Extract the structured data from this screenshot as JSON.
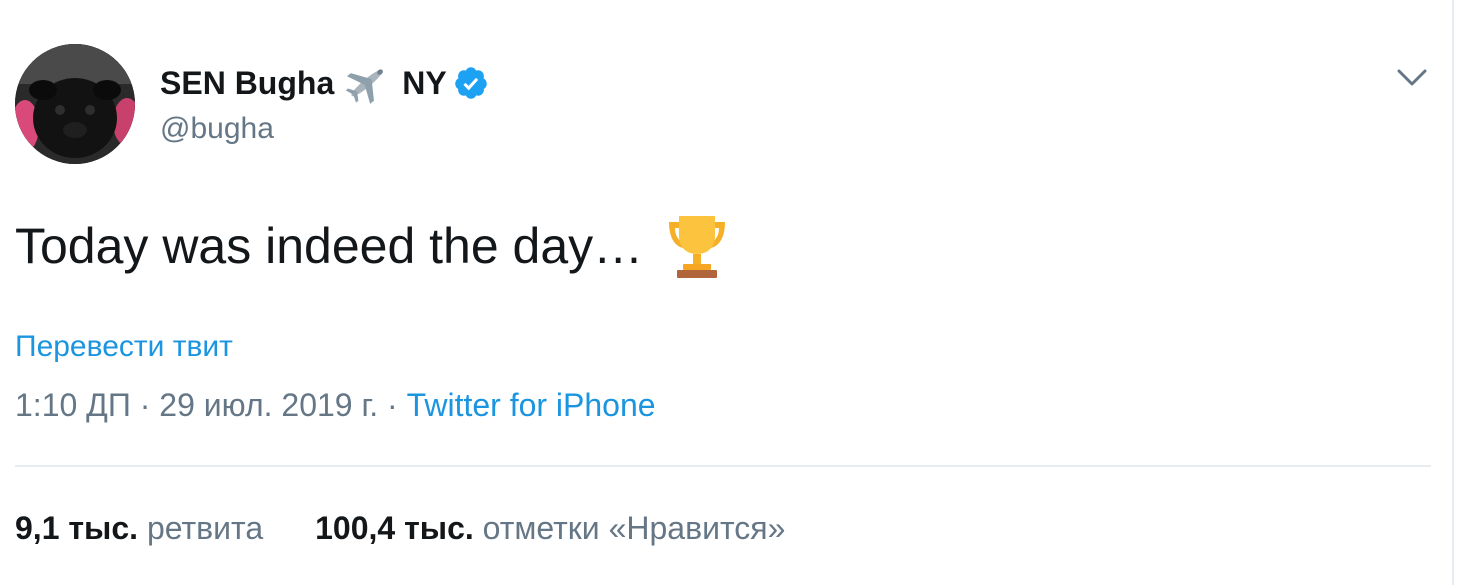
{
  "author": {
    "display_name": "SEN Bugha",
    "location": "NY",
    "username": "@bugha",
    "avatar_icon": "pug-avatar",
    "plane_icon": "airplane-emoji",
    "verified_icon": "verified-badge-icon",
    "verified_color": "#1da1f2"
  },
  "tweet": {
    "text": "Today was indeed the day…",
    "emoji": "trophy-emoji"
  },
  "translate_label": "Перевести твит",
  "meta": {
    "time": "1:10 ДП",
    "sep1": " · ",
    "date": "29 июл. 2019 г.",
    "sep2": " · ",
    "source": "Twitter for iPhone"
  },
  "stats": {
    "retweets_count": "9,1 тыс.",
    "retweets_label": "ретвита",
    "likes_count": "100,4 тыс.",
    "likes_label": "отметки «Нравится»"
  },
  "colors": {
    "link": "#1b95e0",
    "secondary_text": "#657786",
    "primary_text": "#14171a",
    "divider": "#e6ecf0"
  }
}
